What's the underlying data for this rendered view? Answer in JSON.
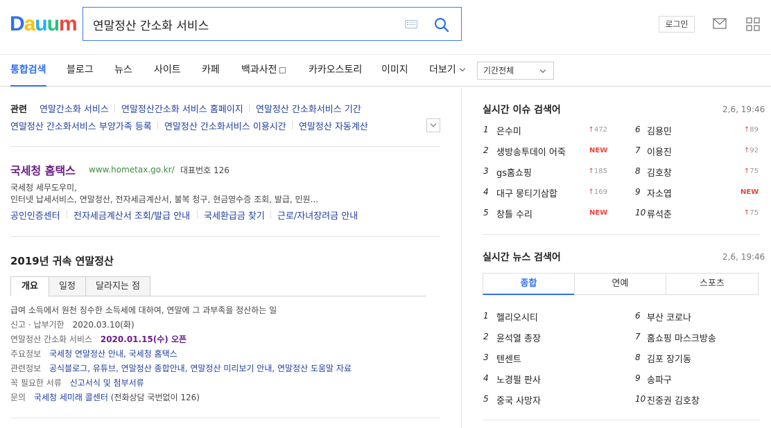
{
  "header": {
    "logo": [
      "D",
      "a",
      "u",
      "u",
      "m"
    ],
    "search_value": "연말정산 간소화 서비스",
    "login_label": "로그인"
  },
  "nav": {
    "items": [
      "통합검색",
      "블로그",
      "뉴스",
      "사이트",
      "카페",
      "백과사전",
      "카카오스토리",
      "이미지",
      "더보기"
    ],
    "period": "기간전체"
  },
  "related": {
    "title": "관련",
    "links": [
      "연말간소화 서비스",
      "연말정산간소화 서비스 홈페이지",
      "연말정산 간소화서비스 기간",
      "연말정산 간소화서비스 부양가족 등록",
      "연말정산 간소화서비스 이용시간",
      "연말정산 자동계산"
    ]
  },
  "hometax": {
    "title": "국세청 홈택스",
    "url": "www.hometax.go.kr/",
    "phone": "대표번호 126",
    "desc1": "국세청 세무도우미,",
    "desc2": "인터넷 납세서비스, 연말정산, 전자세금계산서, 불복 청구, 현금영수증 조회, 발급, 민원...",
    "links": [
      "공인인증센터",
      "전자세금계산서 조회/발급 안내",
      "국세환급금 찾기",
      "근로/자녀장려금 안내"
    ]
  },
  "yearend": {
    "title": "2019년 귀속 연말정산",
    "tabs": [
      "개요",
      "일정",
      "달라지는 점"
    ],
    "summary": "급여 소득에서 원천 징수한 소득세에 대하여, 연말에 그 과부족을 정산하는 일",
    "rows": [
      {
        "label": "신고 · 납부기한",
        "value": "2020.03.10(화)"
      },
      {
        "label": "연말정산 간소화 서비스",
        "value": "2020.01.15(수) 오픈"
      },
      {
        "label": "주요정보",
        "value": "국세청 연말정산 안내, 국세청 홈택스"
      },
      {
        "label": "관련정보",
        "value": "공식블로그, 유튜브, 연말정산 종합안내, 연말정산 미리보기 안내, 연말정산 도움말 자료"
      },
      {
        "label": "꼭 필요한 서류",
        "value": "신고서식 및 첨부서류"
      },
      {
        "label": "문의",
        "value": "국세청 세미래 콜센터",
        "extra": "(전화상담 국번없이 126)"
      }
    ]
  },
  "issue": {
    "title": "실시간 이슈 검색어",
    "time": "2,6, 19:46",
    "left": [
      {
        "rank": "1",
        "text": "은수미",
        "change": "472"
      },
      {
        "rank": "2",
        "text": "생방송투데이 어죽",
        "change": "NEW"
      },
      {
        "rank": "3",
        "text": "gs홈쇼핑",
        "change": "185"
      },
      {
        "rank": "4",
        "text": "대구 뭉티기삼합",
        "change": "169"
      },
      {
        "rank": "5",
        "text": "창틀 수리",
        "change": "NEW"
      }
    ],
    "right": [
      {
        "rank": "6",
        "text": "김용민",
        "change": "89"
      },
      {
        "rank": "7",
        "text": "이용진",
        "change": "92"
      },
      {
        "rank": "8",
        "text": "김호창",
        "change": "75"
      },
      {
        "rank": "9",
        "text": "자소엽",
        "change": "NEW"
      },
      {
        "rank": "10",
        "text": "류석춘",
        "change": "75"
      }
    ]
  },
  "news": {
    "title": "실시간 뉴스 검색어",
    "time": "2,6, 19:46",
    "tabs": [
      "종합",
      "연예",
      "스포츠"
    ],
    "left": [
      {
        "rank": "1",
        "text": "헬리오시티"
      },
      {
        "rank": "2",
        "text": "윤석열 총장"
      },
      {
        "rank": "3",
        "text": "텐센트"
      },
      {
        "rank": "4",
        "text": "노경필 판사"
      },
      {
        "rank": "5",
        "text": "중국 사망자"
      }
    ],
    "right": [
      {
        "rank": "6",
        "text": "부산 코로나"
      },
      {
        "rank": "7",
        "text": "홈쇼핑 마스크방송"
      },
      {
        "rank": "8",
        "text": "김포 장기동"
      },
      {
        "rank": "9",
        "text": "송파구"
      },
      {
        "rank": "10",
        "text": "진중권 김호창"
      }
    ]
  }
}
